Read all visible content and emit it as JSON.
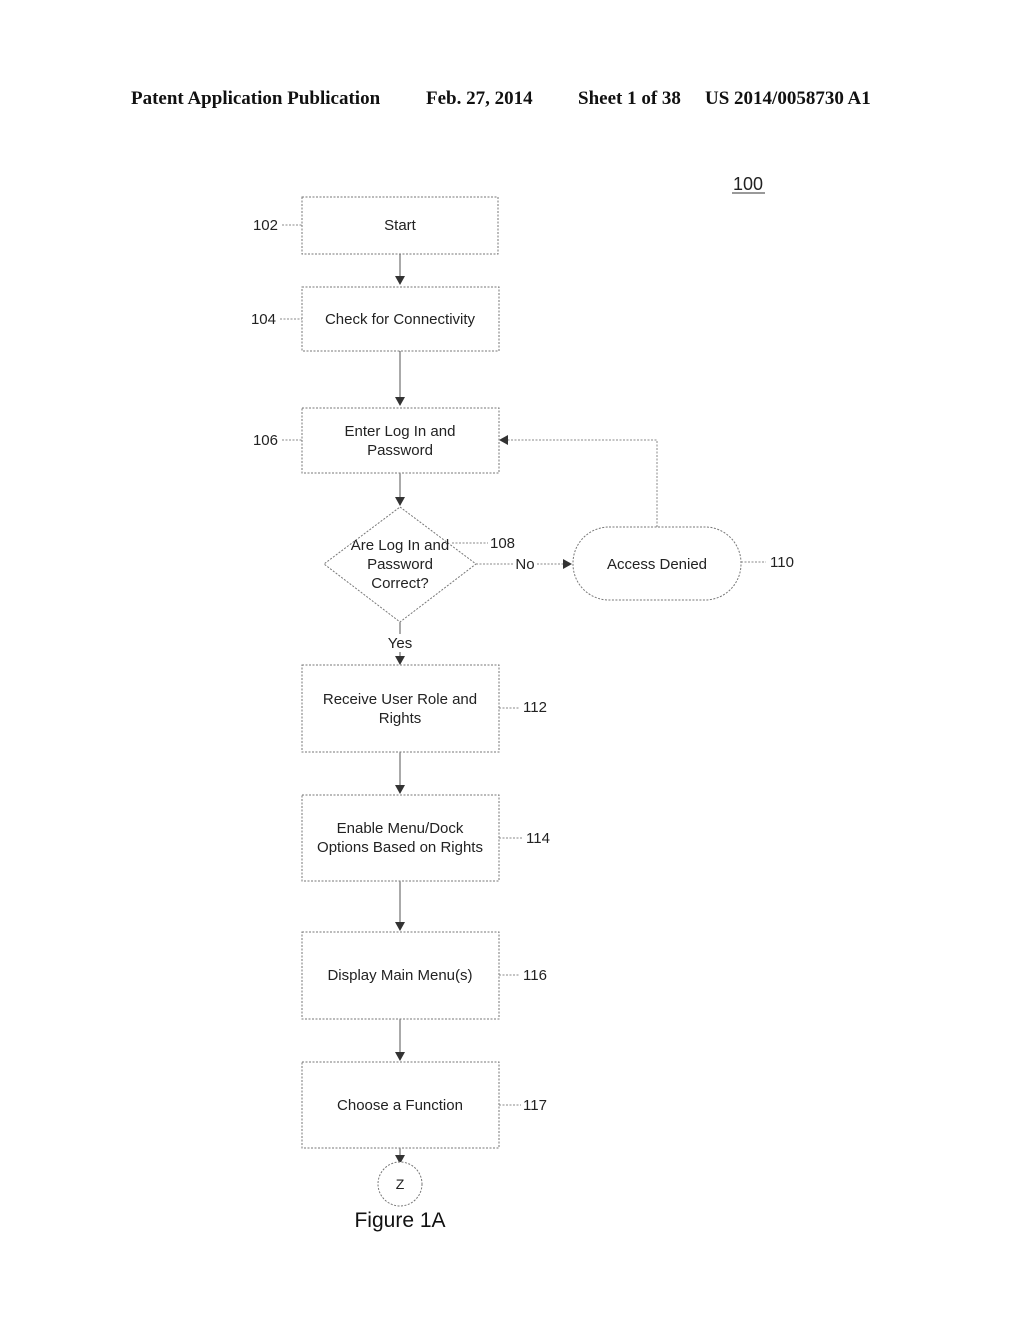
{
  "header": {
    "publication_type": "Patent Application Publication",
    "date": "Feb. 27, 2014",
    "sheet": "Sheet 1 of 38",
    "pub_number": "US 2014/0058730 A1"
  },
  "diagram": {
    "id": "100",
    "figure_caption": "Figure 1A",
    "nodes": [
      {
        "ref": "102",
        "type": "process",
        "lines": [
          "Start"
        ]
      },
      {
        "ref": "104",
        "type": "process",
        "lines": [
          "Check for Connectivity"
        ]
      },
      {
        "ref": "106",
        "type": "process",
        "lines": [
          "Enter Log In and",
          "Password"
        ]
      },
      {
        "ref": "108",
        "type": "decision",
        "lines": [
          "Are Log In and",
          "Password",
          "Correct?"
        ]
      },
      {
        "ref": "110",
        "type": "terminal",
        "lines": [
          "Access Denied"
        ]
      },
      {
        "ref": "112",
        "type": "process",
        "lines": [
          "Receive User Role and",
          "Rights"
        ]
      },
      {
        "ref": "114",
        "type": "process",
        "lines": [
          "Enable Menu/Dock",
          "Options Based on Rights"
        ]
      },
      {
        "ref": "116",
        "type": "process",
        "lines": [
          "Display Main Menu(s)"
        ]
      },
      {
        "ref": "117",
        "type": "process",
        "lines": [
          "Choose a Function"
        ]
      },
      {
        "ref": "",
        "type": "connector",
        "lines": [
          "Z"
        ]
      }
    ],
    "edges": [
      {
        "from": "102",
        "to": "104",
        "label": ""
      },
      {
        "from": "104",
        "to": "106",
        "label": ""
      },
      {
        "from": "106",
        "to": "108",
        "label": ""
      },
      {
        "from": "108",
        "to": "110",
        "label": "No"
      },
      {
        "from": "110",
        "to": "106",
        "label": ""
      },
      {
        "from": "108",
        "to": "112",
        "label": "Yes"
      },
      {
        "from": "112",
        "to": "114",
        "label": ""
      },
      {
        "from": "114",
        "to": "116",
        "label": ""
      },
      {
        "from": "116",
        "to": "117",
        "label": ""
      },
      {
        "from": "117",
        "to": "Z",
        "label": ""
      }
    ]
  }
}
